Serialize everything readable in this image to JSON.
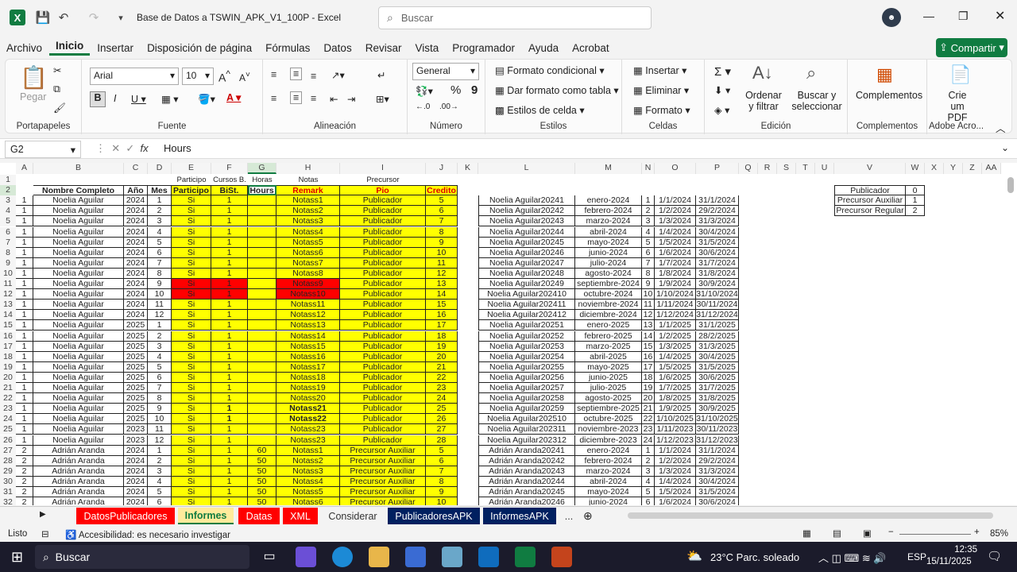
{
  "title": "Base de Datos a TSWIN_APK_V1_100P  -  Excel",
  "search_placeholder": "Buscar",
  "menu": [
    "Archivo",
    "Inicio",
    "Insertar",
    "Disposición de página",
    "Fórmulas",
    "Datos",
    "Revisar",
    "Vista",
    "Programador",
    "Ayuda",
    "Acrobat"
  ],
  "share": "Compartir",
  "ribbon": {
    "paste": "Pegar",
    "portapapeles": "Portapapeles",
    "font_name": "Arial",
    "font_size": "10",
    "fuente": "Fuente",
    "alineacion": "Alineación",
    "numfmt": "General",
    "numero": "Número",
    "fmt_cond": "Formato condicional",
    "fmt_table": "Dar formato como tabla",
    "cell_styles": "Estilos de celda",
    "estilos": "Estilos",
    "insertar": "Insertar",
    "eliminar": "Eliminar",
    "formato": "Formato",
    "celdas": "Celdas",
    "ordenar": "Ordenar y filtrar",
    "buscar": "Buscar y seleccionar",
    "edicion": "Edición",
    "complementos": "Complementos",
    "complementos_g": "Complementos",
    "crie": "Crie um PDF",
    "adobe": "Adobe Acro..."
  },
  "namebox": "G2",
  "formula": "Hours",
  "columns": [
    "A",
    "B",
    "C",
    "D",
    "E",
    "F",
    "G",
    "H",
    "I",
    "J",
    "K",
    "L",
    "M",
    "N",
    "O",
    "P",
    "Q",
    "R",
    "S",
    "T",
    "U",
    "V",
    "W",
    "X",
    "Y",
    "Z",
    "AA"
  ],
  "row1": {
    "E": "Participo",
    "F": "Cursos B.",
    "G": "Horas",
    "H": "Notas",
    "I": "Precursor"
  },
  "headers": [
    "Nombre Completo",
    "Año",
    "Mes",
    "Participo",
    "BiSt.",
    "Hours",
    "Remark",
    "Pio",
    "Credito"
  ],
  "rows": [
    [
      "1",
      "Noelia Aguilar",
      "2024",
      "1",
      "Si",
      "1",
      "",
      "Notass1",
      "Publicador",
      "5",
      "Noelia Aguilar20241",
      "enero-2024",
      "1",
      "1/1/2024",
      "31/1/2024"
    ],
    [
      "1",
      "Noelia Aguilar",
      "2024",
      "2",
      "Si",
      "1",
      "",
      "Notass2",
      "Publicador",
      "6",
      "Noelia Aguilar20242",
      "febrero-2024",
      "2",
      "1/2/2024",
      "29/2/2024"
    ],
    [
      "1",
      "Noelia Aguilar",
      "2024",
      "3",
      "Si",
      "1",
      "",
      "Notass3",
      "Publicador",
      "7",
      "Noelia Aguilar20243",
      "marzo-2024",
      "3",
      "1/3/2024",
      "31/3/2024"
    ],
    [
      "1",
      "Noelia Aguilar",
      "2024",
      "4",
      "Si",
      "1",
      "",
      "Notass4",
      "Publicador",
      "8",
      "Noelia Aguilar20244",
      "abril-2024",
      "4",
      "1/4/2024",
      "30/4/2024"
    ],
    [
      "1",
      "Noelia Aguilar",
      "2024",
      "5",
      "Si",
      "1",
      "",
      "Notass5",
      "Publicador",
      "9",
      "Noelia Aguilar20245",
      "mayo-2024",
      "5",
      "1/5/2024",
      "31/5/2024"
    ],
    [
      "1",
      "Noelia Aguilar",
      "2024",
      "6",
      "Si",
      "1",
      "",
      "Notass6",
      "Publicador",
      "10",
      "Noelia Aguilar20246",
      "junio-2024",
      "6",
      "1/6/2024",
      "30/6/2024"
    ],
    [
      "1",
      "Noelia Aguilar",
      "2024",
      "7",
      "Si",
      "1",
      "",
      "Notass7",
      "Publicador",
      "11",
      "Noelia Aguilar20247",
      "julio-2024",
      "7",
      "1/7/2024",
      "31/7/2024"
    ],
    [
      "1",
      "Noelia Aguilar",
      "2024",
      "8",
      "Si",
      "1",
      "",
      "Notass8",
      "Publicador",
      "12",
      "Noelia Aguilar20248",
      "agosto-2024",
      "8",
      "1/8/2024",
      "31/8/2024"
    ],
    [
      "1",
      "Noelia Aguilar",
      "2024",
      "9",
      "Si",
      "1",
      "",
      "Notass9",
      "Publicador",
      "13",
      "Noelia Aguilar20249",
      "septiembre-2024",
      "9",
      "1/9/2024",
      "30/9/2024"
    ],
    [
      "1",
      "Noelia Aguilar",
      "2024",
      "10",
      "Si",
      "1",
      "",
      "Notass10",
      "Publicador",
      "14",
      "Noelia Aguilar202410",
      "octubre-2024",
      "10",
      "1/10/2024",
      "31/10/2024"
    ],
    [
      "1",
      "Noelia Aguilar",
      "2024",
      "11",
      "Si",
      "1",
      "",
      "Notass11",
      "Publicador",
      "15",
      "Noelia Aguilar202411",
      "noviembre-2024",
      "11",
      "1/11/2024",
      "30/11/2024"
    ],
    [
      "1",
      "Noelia Aguilar",
      "2024",
      "12",
      "Si",
      "1",
      "",
      "Notass12",
      "Publicador",
      "16",
      "Noelia Aguilar202412",
      "diciembre-2024",
      "12",
      "1/12/2024",
      "31/12/2024"
    ],
    [
      "1",
      "Noelia Aguilar",
      "2025",
      "1",
      "Si",
      "1",
      "",
      "Notass13",
      "Publicador",
      "17",
      "Noelia Aguilar20251",
      "enero-2025",
      "13",
      "1/1/2025",
      "31/1/2025"
    ],
    [
      "1",
      "Noelia Aguilar",
      "2025",
      "2",
      "Si",
      "1",
      "",
      "Notass14",
      "Publicador",
      "18",
      "Noelia Aguilar20252",
      "febrero-2025",
      "14",
      "1/2/2025",
      "28/2/2025"
    ],
    [
      "1",
      "Noelia Aguilar",
      "2025",
      "3",
      "Si",
      "1",
      "",
      "Notass15",
      "Publicador",
      "19",
      "Noelia Aguilar20253",
      "marzo-2025",
      "15",
      "1/3/2025",
      "31/3/2025"
    ],
    [
      "1",
      "Noelia Aguilar",
      "2025",
      "4",
      "Si",
      "1",
      "",
      "Notass16",
      "Publicador",
      "20",
      "Noelia Aguilar20254",
      "abril-2025",
      "16",
      "1/4/2025",
      "30/4/2025"
    ],
    [
      "1",
      "Noelia Aguilar",
      "2025",
      "5",
      "Si",
      "1",
      "",
      "Notass17",
      "Publicador",
      "21",
      "Noelia Aguilar20255",
      "mayo-2025",
      "17",
      "1/5/2025",
      "31/5/2025"
    ],
    [
      "1",
      "Noelia Aguilar",
      "2025",
      "6",
      "Si",
      "1",
      "",
      "Notass18",
      "Publicador",
      "22",
      "Noelia Aguilar20256",
      "junio-2025",
      "18",
      "1/6/2025",
      "30/6/2025"
    ],
    [
      "1",
      "Noelia Aguilar",
      "2025",
      "7",
      "Si",
      "1",
      "",
      "Notass19",
      "Publicador",
      "23",
      "Noelia Aguilar20257",
      "julio-2025",
      "19",
      "1/7/2025",
      "31/7/2025"
    ],
    [
      "1",
      "Noelia Aguilar",
      "2025",
      "8",
      "Si",
      "1",
      "",
      "Notass20",
      "Publicador",
      "24",
      "Noelia Aguilar20258",
      "agosto-2025",
      "20",
      "1/8/2025",
      "31/8/2025"
    ],
    [
      "1",
      "Noelia Aguilar",
      "2025",
      "9",
      "Si",
      "1",
      "",
      "Notass21",
      "Publicador",
      "25",
      "Noelia Aguilar20259",
      "septiembre-2025",
      "21",
      "1/9/2025",
      "30/9/2025"
    ],
    [
      "1",
      "Noelia Aguilar",
      "2025",
      "10",
      "Si",
      "1",
      "",
      "Notass22",
      "Publicador",
      "26",
      "Noelia Aguilar202510",
      "octubre-2025",
      "22",
      "1/10/2025",
      "31/10/2025"
    ],
    [
      "1",
      "Noelia Aguilar",
      "2023",
      "11",
      "Si",
      "1",
      "",
      "Notass23",
      "Publicador",
      "27",
      "Noelia Aguilar202311",
      "noviembre-2023",
      "23",
      "1/11/2023",
      "30/11/2023"
    ],
    [
      "1",
      "Noelia Aguilar",
      "2023",
      "12",
      "Si",
      "1",
      "",
      "Notass23",
      "Publicador",
      "28",
      "Noelia Aguilar202312",
      "diciembre-2023",
      "24",
      "1/12/2023",
      "31/12/2023"
    ],
    [
      "2",
      "Adrián Aranda",
      "2024",
      "1",
      "Si",
      "1",
      "60",
      "Notass1",
      "Precursor Auxiliar",
      "5",
      "Adrián Aranda20241",
      "enero-2024",
      "1",
      "1/1/2024",
      "31/1/2024"
    ],
    [
      "2",
      "Adrián Aranda",
      "2024",
      "2",
      "Si",
      "1",
      "50",
      "Notass2",
      "Precursor Auxiliar",
      "6",
      "Adrián Aranda20242",
      "febrero-2024",
      "2",
      "1/2/2024",
      "29/2/2024"
    ],
    [
      "2",
      "Adrián Aranda",
      "2024",
      "3",
      "Si",
      "1",
      "50",
      "Notass3",
      "Precursor Auxiliar",
      "7",
      "Adrián Aranda20243",
      "marzo-2024",
      "3",
      "1/3/2024",
      "31/3/2024"
    ],
    [
      "2",
      "Adrián Aranda",
      "2024",
      "4",
      "Si",
      "1",
      "50",
      "Notass4",
      "Precursor Auxiliar",
      "8",
      "Adrián Aranda20244",
      "abril-2024",
      "4",
      "1/4/2024",
      "30/4/2024"
    ],
    [
      "2",
      "Adrián Aranda",
      "2024",
      "5",
      "Si",
      "1",
      "50",
      "Notass5",
      "Precursor Auxiliar",
      "9",
      "Adrián Aranda20245",
      "mayo-2024",
      "5",
      "1/5/2024",
      "31/5/2024"
    ],
    [
      "2",
      "Adrián Aranda",
      "2024",
      "6",
      "Si",
      "1",
      "50",
      "Notass6",
      "Precursor Auxiliar",
      "10",
      "Adrián Aranda20246",
      "junio-2024",
      "6",
      "1/6/2024",
      "30/6/2024"
    ]
  ],
  "lookup": [
    [
      "Publicador",
      "0"
    ],
    [
      "Precursor Auxiliar",
      "1"
    ],
    [
      "Precursor Regular",
      "2"
    ]
  ],
  "tabs": [
    "DatosPublicadores",
    "Informes",
    "Datas",
    "XML",
    "Considerar",
    "PublicadoresAPK",
    "InformesAPK",
    "..."
  ],
  "status": {
    "ready": "Listo",
    "access": "Accesibilidad: es necesario investigar",
    "zoom": "85%"
  },
  "taskbar": {
    "search": "Buscar",
    "weather": "23°C  Parc. soleado",
    "lang": "ESP",
    "time": "12:35",
    "date": "15/11/2025"
  }
}
